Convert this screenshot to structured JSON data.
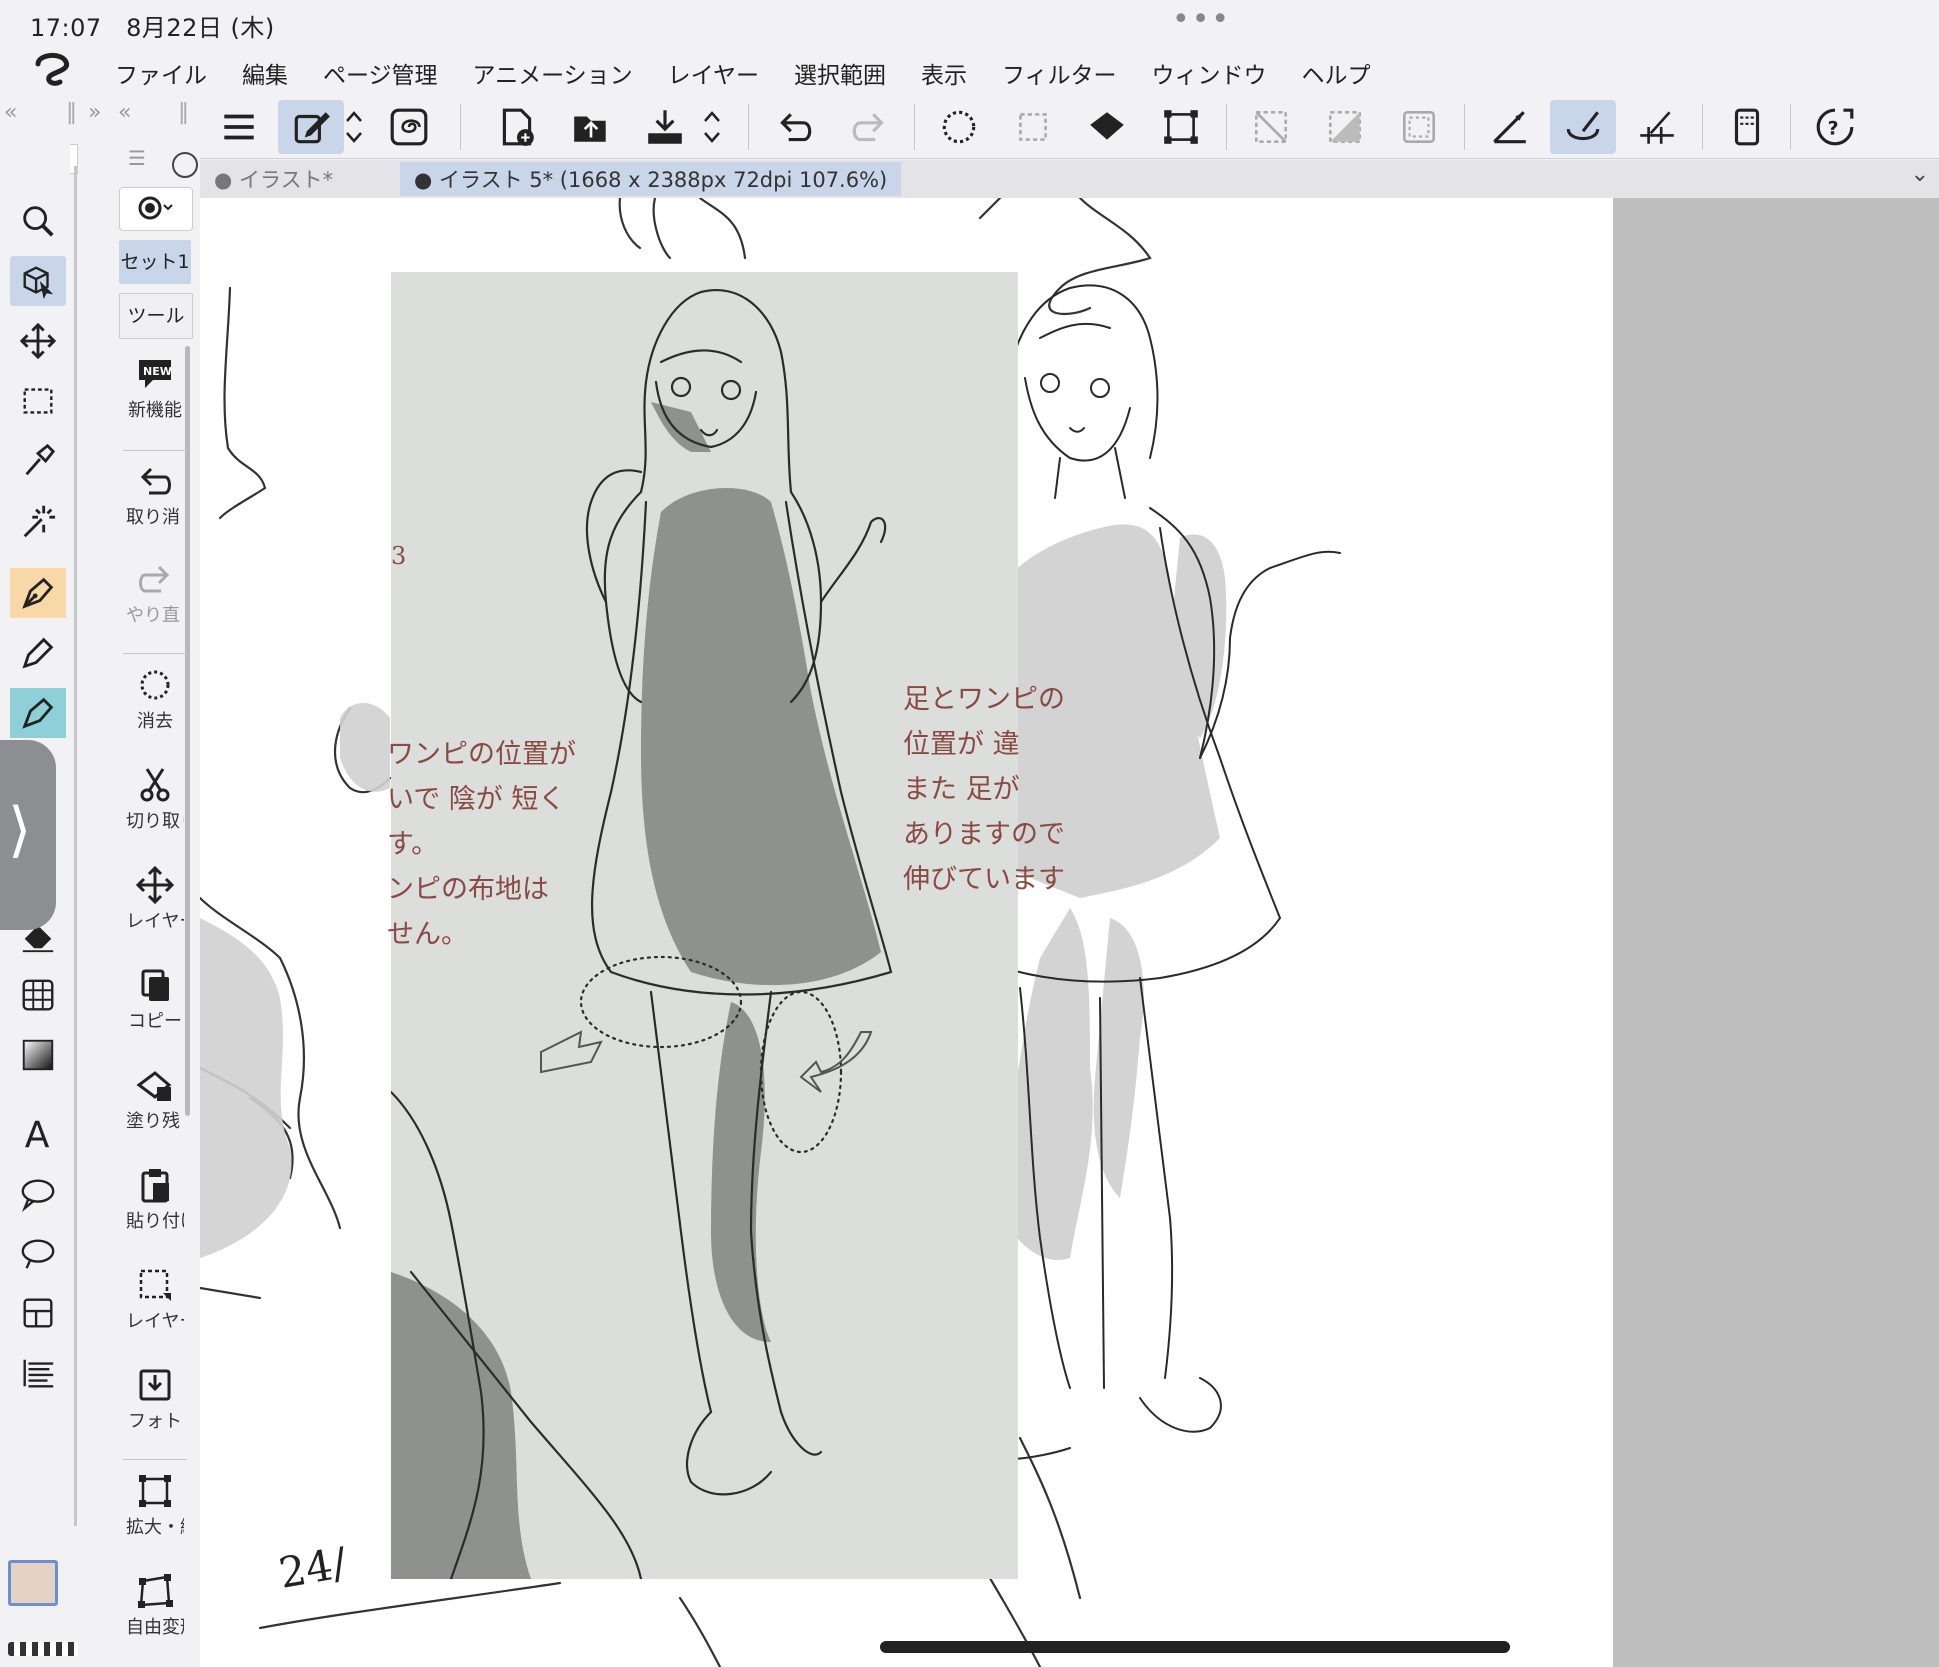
{
  "status_bar": {
    "time": "17:07",
    "date": "8月22日 (木)",
    "more": "•••"
  },
  "menu": {
    "items": [
      "ファイル",
      "編集",
      "ページ管理",
      "アニメーション",
      "レイヤー",
      "選択範囲",
      "表示",
      "フィルター",
      "ウィンドウ",
      "ヘルプ"
    ]
  },
  "tabs": [
    {
      "label": "● イラスト*",
      "active": false
    },
    {
      "label": "● イラスト 5* (1668 x 2388px 72dpi 107.6%)",
      "active": true
    }
  ],
  "subtool_panel": {
    "search_icon": "search-icon",
    "set_label": "セット1",
    "tool_label": "ツール",
    "items": [
      {
        "label": "新機能",
        "icon": "new-badge-icon",
        "enabled": true
      },
      {
        "label": "取り消し",
        "icon": "undo-icon",
        "enabled": true
      },
      {
        "label": "やり直し",
        "icon": "redo-icon",
        "enabled": false
      },
      {
        "label": "消去",
        "icon": "clear-icon",
        "enabled": true
      },
      {
        "label": "切り取り",
        "icon": "scissors-icon",
        "enabled": true
      },
      {
        "label": "レイヤー移動",
        "icon": "move-icon",
        "enabled": true
      },
      {
        "label": "コピー",
        "icon": "copy-icon",
        "enabled": true
      },
      {
        "label": "塗り残し",
        "icon": "fill-remain-icon",
        "enabled": true
      },
      {
        "label": "貼り付け",
        "icon": "paste-icon",
        "enabled": true
      },
      {
        "label": "レイヤー選択",
        "icon": "layer-select-icon",
        "enabled": true
      },
      {
        "label": "フォト",
        "icon": "photo-import-icon",
        "enabled": true
      },
      {
        "label": "拡大・縮小",
        "icon": "scale-icon",
        "enabled": true
      },
      {
        "label": "自由変形",
        "icon": "free-transform-icon",
        "enabled": true
      }
    ]
  },
  "canvas_notes": {
    "left_1": "ワンピの位置が",
    "left_2": "いで 陰が 短く",
    "left_3": "す。",
    "left_4": "ンピの布地は",
    "left_5": "せん。",
    "right_1": "足とワンピの",
    "right_2": "位置が 違",
    "right_3": "また 足が",
    "right_4": "ありますので",
    "right_5": "伸びています",
    "page_number": "24/",
    "margin_mark": "3"
  },
  "colors": {
    "accent_selected": "#c9d6ea",
    "pen_highlight": "#f7d8a6",
    "brush_highlight": "#8fd0d8",
    "main_color": "#e4d2c4",
    "canvas_gray": "#bebebe"
  }
}
